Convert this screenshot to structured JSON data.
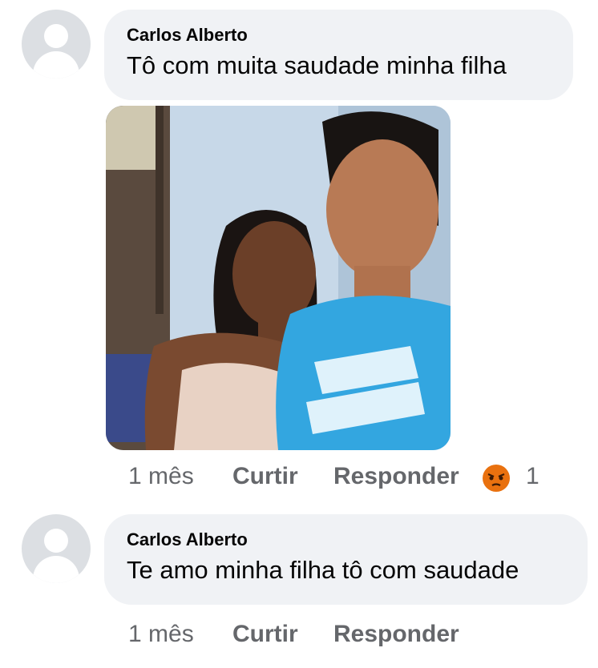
{
  "comments": [
    {
      "author": "Carlos Alberto",
      "text": "Tô com muita saudade minha filha",
      "time": "1 mês",
      "like_label": "Curtir",
      "reply_label": "Responder",
      "reaction_icon": "angry-face-icon",
      "reaction_count": "1"
    },
    {
      "author": "Carlos Alberto",
      "text": "Te amo minha filha tô com saudade",
      "time": "1 mês",
      "like_label": "Curtir",
      "reply_label": "Responder"
    }
  ],
  "colors": {
    "bubble": "#f0f2f5",
    "meta_text": "#65676b",
    "angry_reaction": "#e9710f"
  }
}
